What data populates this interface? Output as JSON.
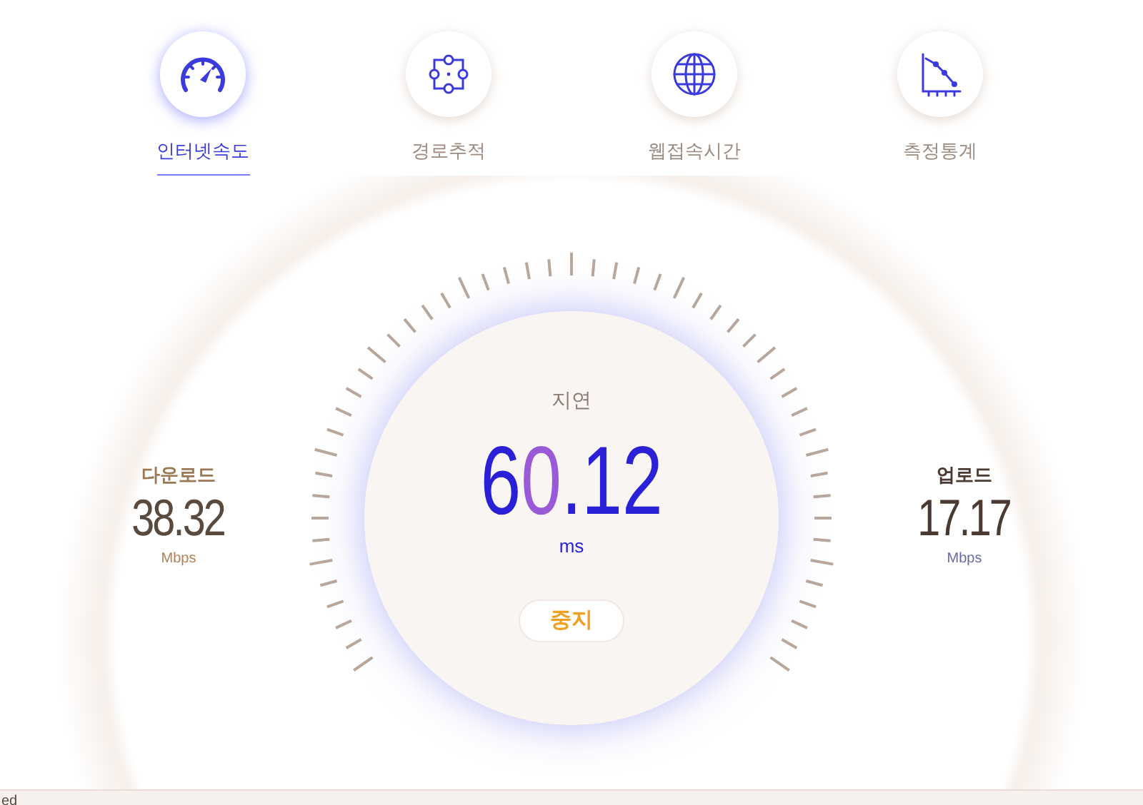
{
  "tabs": [
    {
      "label": "인터넷속도",
      "selected": true
    },
    {
      "label": "경로추적",
      "selected": false
    },
    {
      "label": "웹접속시간",
      "selected": false
    },
    {
      "label": "측정통계",
      "selected": false
    }
  ],
  "download": {
    "label": "다운로드",
    "value": "38.32",
    "unit": "Mbps"
  },
  "latency": {
    "label": "지연",
    "value_head": "6",
    "value_mid": "0",
    "value_tail": ".12",
    "unit": "ms"
  },
  "upload": {
    "label": "업로드",
    "value": "17.17",
    "unit": "Mbps"
  },
  "stop_button": "중지",
  "status_bar": "ed"
}
